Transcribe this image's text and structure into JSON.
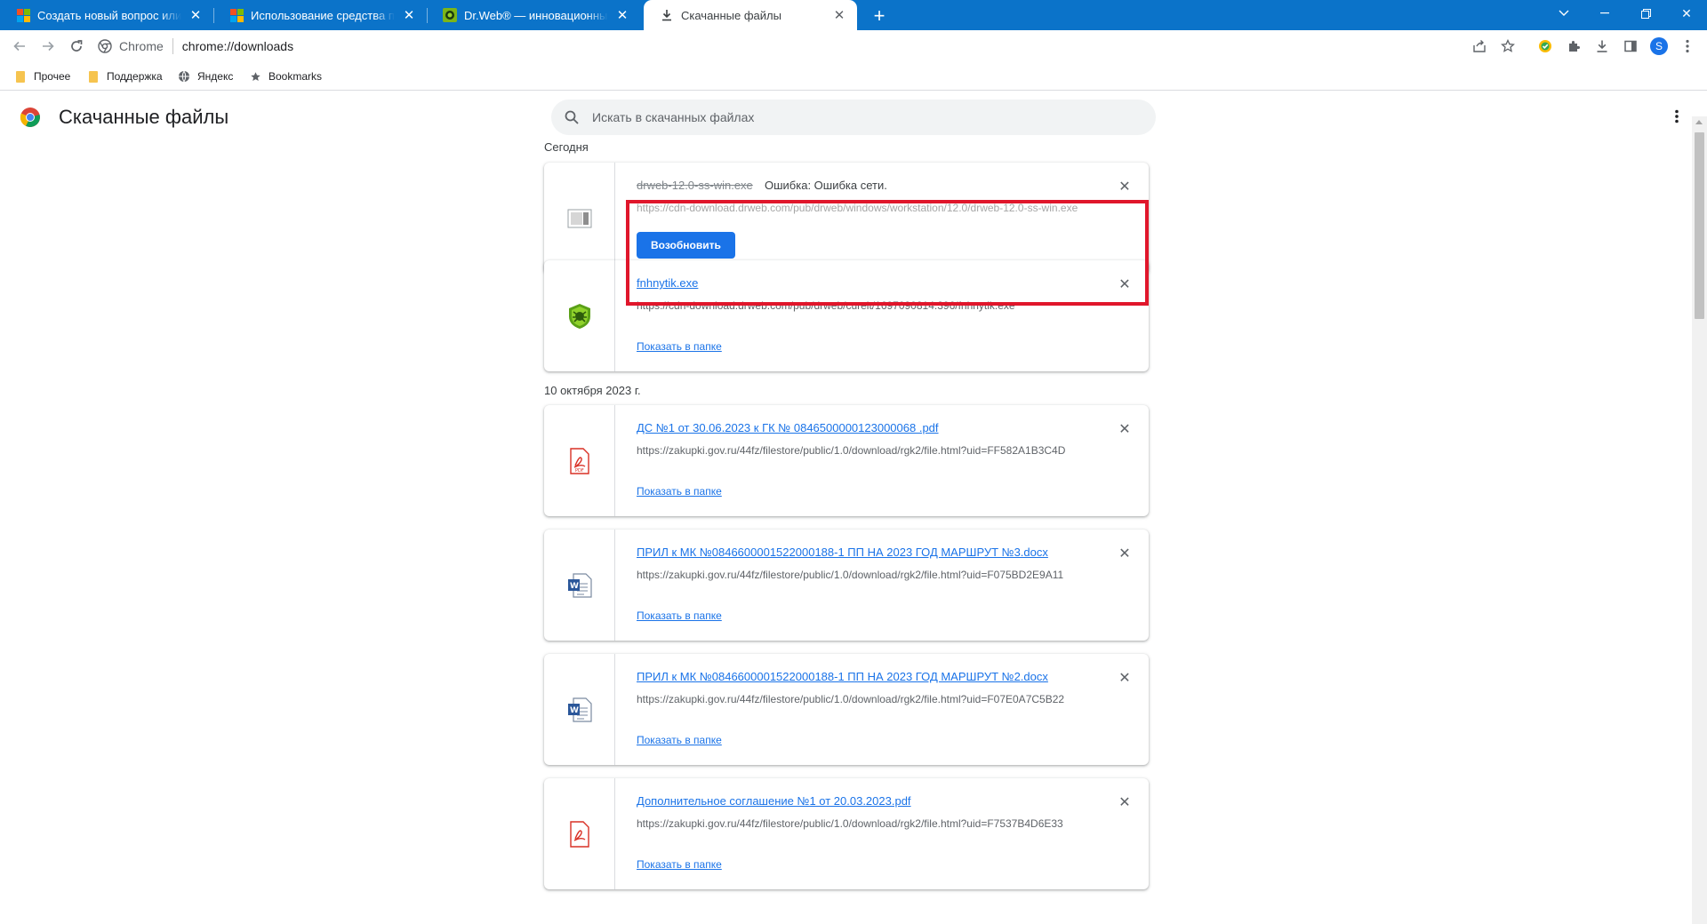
{
  "tabs": [
    {
      "title": "Создать новый вопрос или начать обсуждение",
      "icon": "microsoft-icon"
    },
    {
      "title": "Использование средства проверки системных файлов",
      "icon": "microsoft-icon"
    },
    {
      "title": "Dr.Web® — инновационные технологии",
      "icon": "drweb-icon"
    },
    {
      "title": "Скачанные файлы",
      "icon": "download-icon"
    }
  ],
  "toolbar": {
    "chip_label": "Chrome",
    "url": "chrome://downloads",
    "avatar_letter": "S"
  },
  "bookmarks": [
    {
      "label": "Прочее"
    },
    {
      "label": "Поддержка"
    },
    {
      "label": "Яндекс"
    },
    {
      "label": "Bookmarks"
    }
  ],
  "page": {
    "title": "Скачанные файлы",
    "search_placeholder": "Искать в скачанных файлах"
  },
  "groups": [
    {
      "date": "Сегодня"
    },
    {
      "date": "10 октября 2023 г."
    }
  ],
  "downloads": [
    {
      "name": "drweb-12.0-ss-win.exe",
      "status": "Ошибка: Ошибка сети.",
      "url": "https://cdn-download.drweb.com/pub/drweb/windows/workstation/12.0/drweb-12.0-ss-win.exe",
      "action": "Возобновить",
      "icon": "generic-file-icon"
    },
    {
      "name": "fnhnytik.exe",
      "url": "https://cdn-download.drweb.com/pub/drweb/cureit/1697090814.396/fnhnytik.exe",
      "action": "Показать в папке",
      "icon": "drweb-spider-icon"
    },
    {
      "name": "ДС №1 от 30.06.2023 к ГК № 0846500000123000068 .pdf",
      "url": "https://zakupki.gov.ru/44fz/filestore/public/1.0/download/rgk2/file.html?uid=FF582A1B3C4D",
      "action": "Показать в папке",
      "icon": "pdf-icon"
    },
    {
      "name": "ПРИЛ к МК №0846600001522000188-1 ПП НА 2023 ГОД МАРШРУТ №3.docx",
      "url": "https://zakupki.gov.ru/44fz/filestore/public/1.0/download/rgk2/file.html?uid=F075BD2E9A11",
      "action": "Показать в папке",
      "icon": "docx-icon"
    },
    {
      "name": "ПРИЛ к МК №0846600001522000188-1 ПП НА 2023 ГОД МАРШРУТ №2.docx",
      "url": "https://zakupki.gov.ru/44fz/filestore/public/1.0/download/rgk2/file.html?uid=F07E0A7C5B22",
      "action": "Показать в папке",
      "icon": "docx-icon"
    },
    {
      "name": "Дополнительное соглашение №1 от 20.03.2023.pdf",
      "url": "https://zakupki.gov.ru/44fz/filestore/public/1.0/download/rgk2/file.html?uid=F7537B4D6E33",
      "action": "Показать в папке",
      "icon": "pdf-icon"
    }
  ],
  "colors": {
    "tabstrip": "#0b73c9",
    "accent": "#1a73e8",
    "highlight": "#e0162b"
  }
}
